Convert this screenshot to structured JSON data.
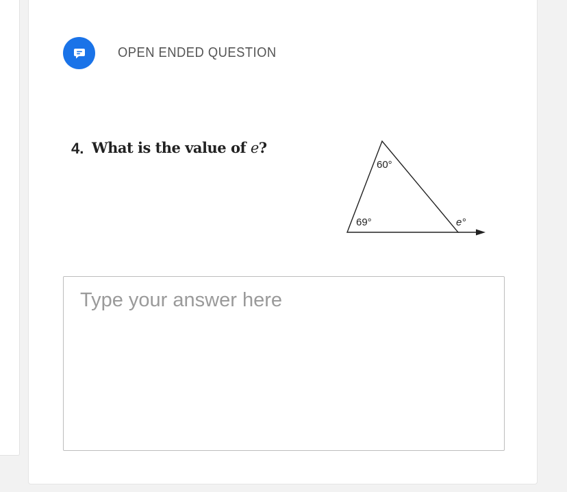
{
  "question_type": {
    "label": "OPEN ENDED QUESTION",
    "icon": "comment-icon",
    "color": "#1a73e8"
  },
  "question": {
    "number": "4.",
    "text_prefix": "What is the value of ",
    "variable": "e",
    "text_suffix": "?"
  },
  "figure": {
    "angle_top": "60°",
    "angle_bottom_left": "69°",
    "angle_exterior": "e°"
  },
  "answer": {
    "placeholder": "Type your answer here",
    "value": ""
  }
}
